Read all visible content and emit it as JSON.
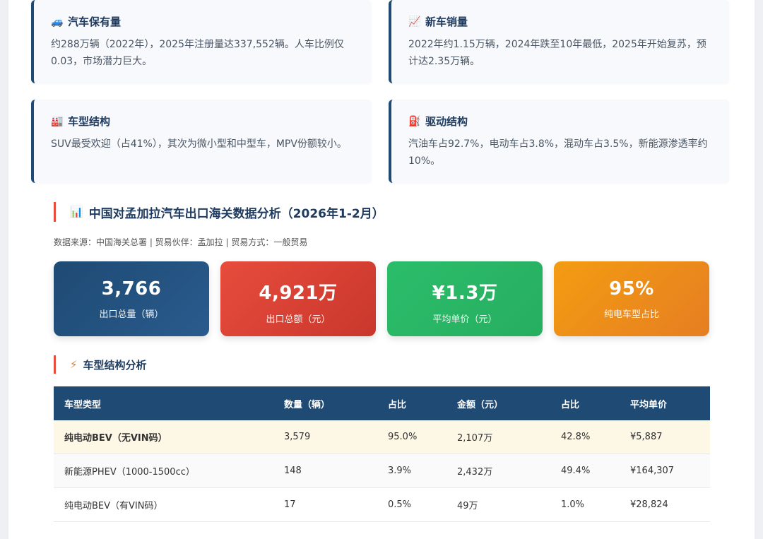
{
  "cards": [
    {
      "icon": "🚙",
      "title": "汽车保有量",
      "body": "约288万辆（2022年），2025年注册量达337,552辆。人车比例仅0.03，市场潜力巨大。"
    },
    {
      "icon": "📈",
      "title": "新车销量",
      "body": "2022年约1.15万辆，2024年跌至10年最低，2025年开始复苏，预计达2.35万辆。"
    },
    {
      "icon": "🏭",
      "title": "车型结构",
      "body": "SUV最受欢迎（占41%），其次为微小型和中型车，MPV份额较小。"
    },
    {
      "icon": "⛽",
      "title": "驱动结构",
      "body": "汽油车占92.7%，电动车占3.8%，混动车占3.5%，新能源渗透率约10%。"
    }
  ],
  "section_main": {
    "icon": "📊",
    "title": "中国对孟加拉汽车出口海关数据分析（2026年1-2月）"
  },
  "source": "数据来源：中国海关总署 | 贸易伙伴：孟加拉 | 贸易方式：一般贸易",
  "kpis": [
    {
      "value": "3,766",
      "label": "出口总量（辆）",
      "color": "#1e4a73"
    },
    {
      "value": "4,921万",
      "label": "出口总额（元）",
      "color": "#d9443a"
    },
    {
      "value": "¥1.3万",
      "label": "平均单价（元）",
      "color": "#2ab564"
    },
    {
      "value": "95%",
      "label": "纯电车型占比",
      "color": "#ee8a1a"
    }
  ],
  "section_sub": {
    "icon": "⚡",
    "title": "车型结构分析"
  },
  "table": {
    "headers": [
      "车型类型",
      "数量（辆）",
      "占比",
      "金额（元）",
      "占比",
      "平均单价"
    ],
    "rows": [
      [
        "纯电动BEV（无VIN码）",
        "3,579",
        "95.0%",
        "2,107万",
        "42.8%",
        "¥5,887"
      ],
      [
        "新能源PHEV（1000-1500cc）",
        "148",
        "3.9%",
        "2,432万",
        "49.4%",
        "¥164,307"
      ],
      [
        "纯电动BEV（有VIN码）",
        "17",
        "0.5%",
        "49万",
        "1.0%",
        "¥28,824"
      ]
    ]
  }
}
